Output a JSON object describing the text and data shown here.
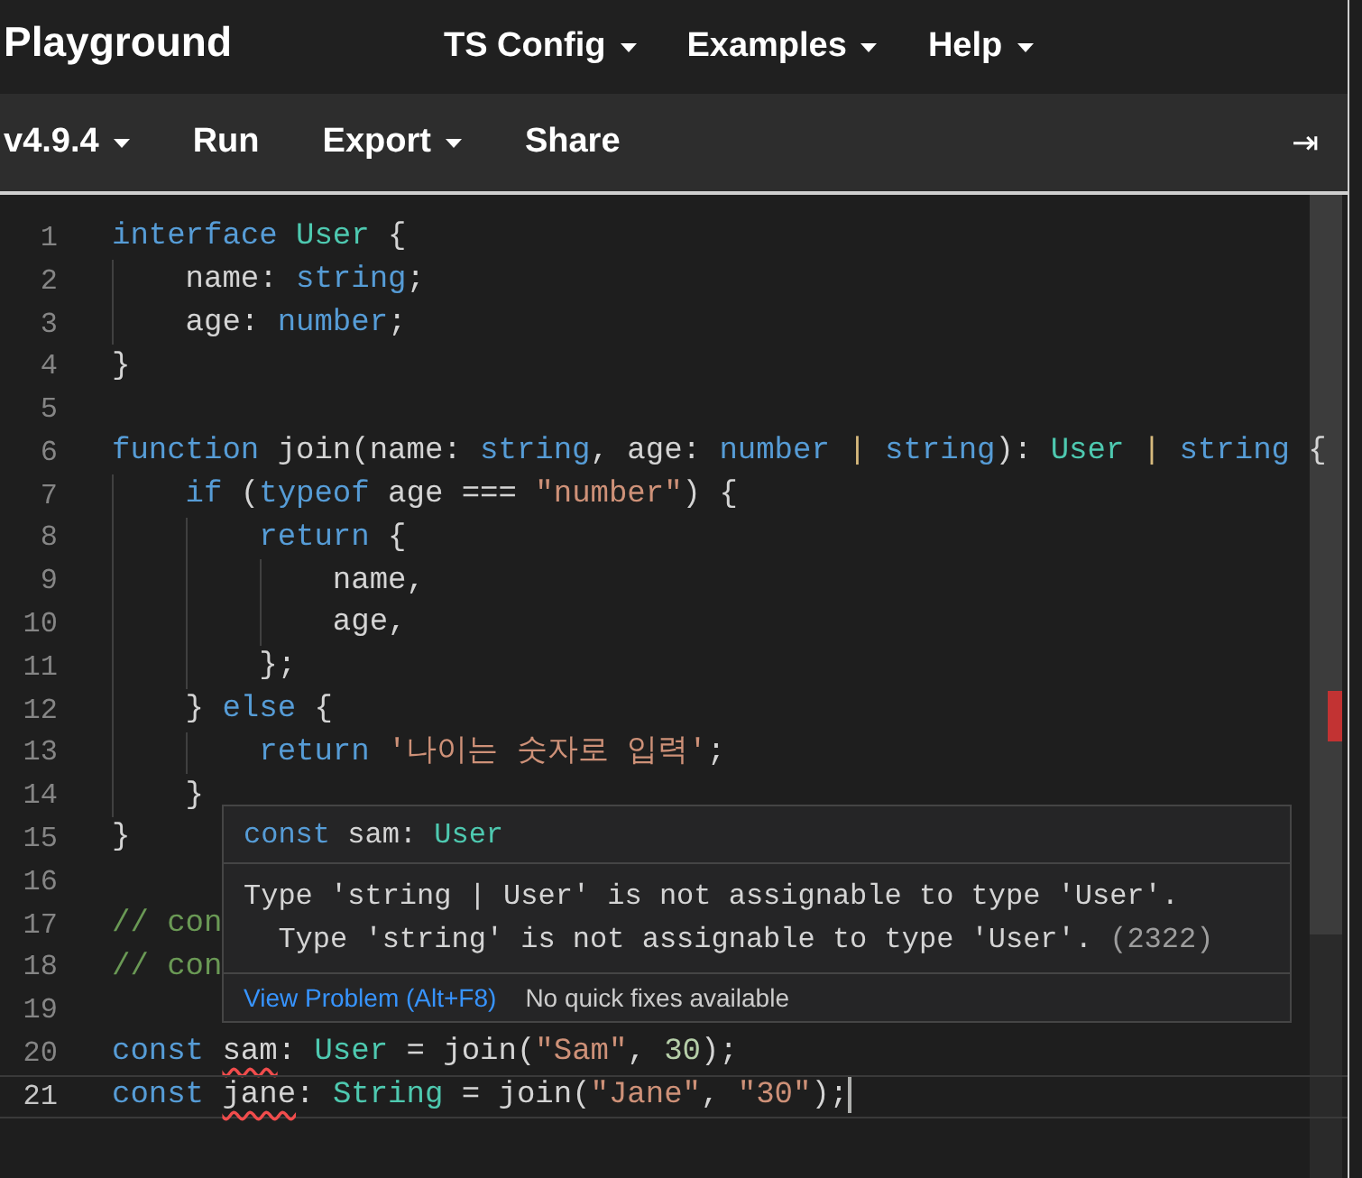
{
  "header": {
    "title": "Playground",
    "menus": [
      {
        "label": "TS Config"
      },
      {
        "label": "Examples"
      },
      {
        "label": "Help"
      }
    ]
  },
  "toolbar": {
    "items": [
      {
        "label": "v4.9.4",
        "dropdown": true
      },
      {
        "label": "Run",
        "dropdown": false
      },
      {
        "label": "Export",
        "dropdown": true
      },
      {
        "label": "Share",
        "dropdown": false
      }
    ],
    "collapse": "⇥"
  },
  "editor": {
    "lines": [
      {
        "number": "1",
        "current": false,
        "tokens": [
          {
            "kind": "kw",
            "text": "interface "
          },
          {
            "kind": "type",
            "text": "User"
          },
          {
            "kind": "plain",
            "text": " {"
          }
        ]
      },
      {
        "number": "2",
        "current": false,
        "tokens": [
          {
            "kind": "plain",
            "text": "    name: "
          },
          {
            "kind": "kw",
            "text": "string"
          },
          {
            "kind": "plain",
            "text": ";"
          }
        ]
      },
      {
        "number": "3",
        "current": false,
        "tokens": [
          {
            "kind": "plain",
            "text": "    age: "
          },
          {
            "kind": "kw",
            "text": "number"
          },
          {
            "kind": "plain",
            "text": ";"
          }
        ]
      },
      {
        "number": "4",
        "current": false,
        "tokens": [
          {
            "kind": "plain",
            "text": "}"
          }
        ]
      },
      {
        "number": "5",
        "current": false
      },
      {
        "number": "6",
        "current": false,
        "tokens": [
          {
            "kind": "kw",
            "text": "function "
          },
          {
            "kind": "plain",
            "text": "join(name: "
          },
          {
            "kind": "kw",
            "text": "string"
          },
          {
            "kind": "plain",
            "text": ", age: "
          },
          {
            "kind": "kw",
            "text": "number"
          },
          {
            "kind": "pipe",
            "text": " | "
          },
          {
            "kind": "kw",
            "text": "string"
          },
          {
            "kind": "plain",
            "text": "): "
          },
          {
            "kind": "type",
            "text": "User"
          },
          {
            "kind": "pipe",
            "text": " | "
          },
          {
            "kind": "kw",
            "text": "string"
          },
          {
            "kind": "plain",
            "text": " {"
          }
        ]
      },
      {
        "number": "7",
        "current": false,
        "tokens": [
          {
            "kind": "kw",
            "text": "    if "
          },
          {
            "kind": "plain",
            "text": "("
          },
          {
            "kind": "kw",
            "text": "typeof "
          },
          {
            "kind": "plain",
            "text": "age === "
          },
          {
            "kind": "str",
            "text": "\"number\""
          },
          {
            "kind": "plain",
            "text": ") {"
          }
        ]
      },
      {
        "number": "8",
        "current": false,
        "tokens": [
          {
            "kind": "kw",
            "text": "        return "
          },
          {
            "kind": "plain",
            "text": "{"
          }
        ]
      },
      {
        "number": "9",
        "current": false,
        "tokens": [
          {
            "kind": "plain",
            "text": "            name,"
          }
        ]
      },
      {
        "number": "10",
        "current": false,
        "tokens": [
          {
            "kind": "plain",
            "text": "            age,"
          }
        ]
      },
      {
        "number": "11",
        "current": false,
        "tokens": [
          {
            "kind": "plain",
            "text": "        };"
          }
        ]
      },
      {
        "number": "12",
        "current": false,
        "tokens": [
          {
            "kind": "plain",
            "text": "    } "
          },
          {
            "kind": "kw",
            "text": "else "
          },
          {
            "kind": "plain",
            "text": "{"
          }
        ]
      },
      {
        "number": "13",
        "current": false,
        "tokens": [
          {
            "kind": "kw",
            "text": "        return "
          },
          {
            "kind": "str",
            "text": "'나이는 숫자로 입력'"
          },
          {
            "kind": "plain",
            "text": ";"
          }
        ]
      },
      {
        "number": "14",
        "current": false,
        "tokens": [
          {
            "kind": "plain",
            "text": "    }"
          }
        ]
      },
      {
        "number": "15",
        "current": false,
        "tokens": [
          {
            "kind": "plain",
            "text": "}"
          }
        ]
      },
      {
        "number": "16",
        "current": false
      },
      {
        "number": "17",
        "current": false,
        "tokens": [
          {
            "kind": "comment",
            "text": "// con"
          }
        ]
      },
      {
        "number": "18",
        "current": false,
        "tokens": [
          {
            "kind": "comment",
            "text": "// con"
          }
        ]
      },
      {
        "number": "19",
        "current": false
      },
      {
        "number": "20",
        "current": false,
        "tokens": [
          {
            "kind": "kw",
            "text": "const "
          },
          {
            "kind": "plain",
            "text": "sam",
            "error": true
          },
          {
            "kind": "plain",
            "text": ": "
          },
          {
            "kind": "type",
            "text": "User"
          },
          {
            "kind": "plain",
            "text": " = join("
          },
          {
            "kind": "str",
            "text": "\"Sam\""
          },
          {
            "kind": "plain",
            "text": ", "
          },
          {
            "kind": "num",
            "text": "30"
          },
          {
            "kind": "plain",
            "text": ");"
          }
        ]
      },
      {
        "number": "21",
        "current": true,
        "tokens": [
          {
            "kind": "kw",
            "text": "const "
          },
          {
            "kind": "plain",
            "text": "jane",
            "error": true
          },
          {
            "kind": "plain",
            "text": ": "
          },
          {
            "kind": "type",
            "text": "String"
          },
          {
            "kind": "plain",
            "text": " = join("
          },
          {
            "kind": "str",
            "text": "\"Jane\""
          },
          {
            "kind": "plain",
            "text": ", "
          },
          {
            "kind": "str",
            "text": "\"30\""
          },
          {
            "kind": "plain",
            "text": ");"
          }
        ]
      }
    ]
  },
  "hover": {
    "signature": [
      {
        "kind": "kw",
        "text": "const "
      },
      {
        "kind": "plain",
        "text": "sam: "
      },
      {
        "kind": "type",
        "text": "User"
      }
    ],
    "message": [
      "Type 'string | User' is not assignable to type 'User'.",
      "  Type 'string' is not assignable to type 'User'."
    ],
    "code": "(2322)",
    "link": "View Problem (Alt+F8)",
    "note": "No quick fixes available"
  }
}
